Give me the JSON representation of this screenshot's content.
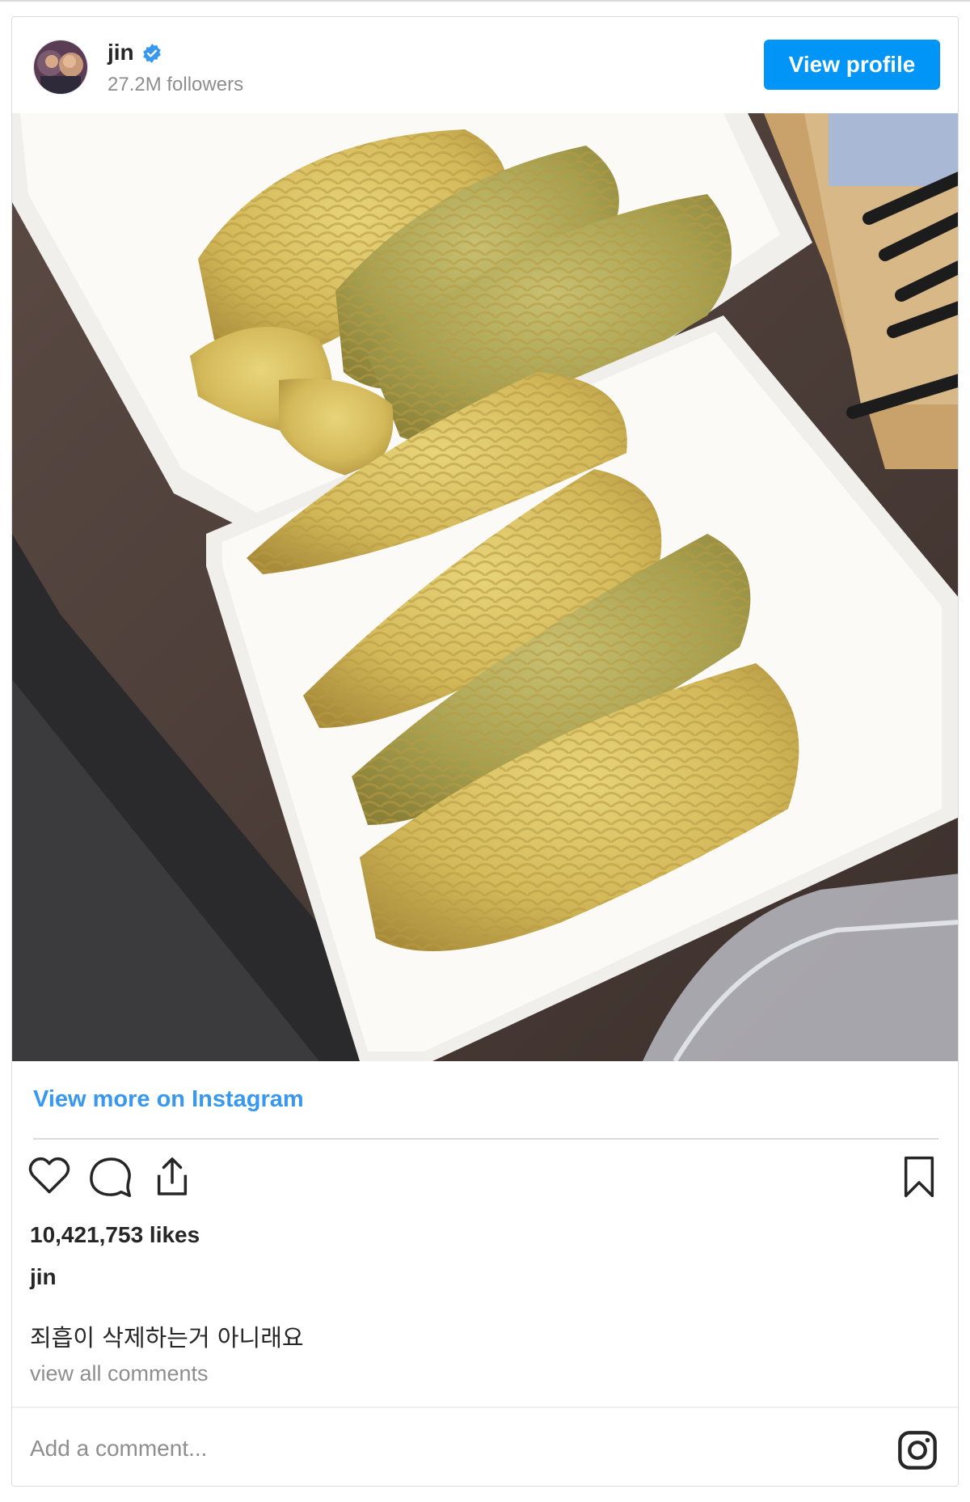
{
  "header": {
    "username": "jin",
    "followers": "27.2M followers",
    "view_profile_label": "View profile"
  },
  "link": {
    "view_more": "View more on Instagram"
  },
  "post": {
    "likes": "10,421,753 likes",
    "author": "jin",
    "caption": "죄흡이 삭제하는거 아니래요",
    "view_comments": "view all comments"
  },
  "comment": {
    "placeholder": "Add a comment..."
  },
  "colors": {
    "accent": "#0095f6",
    "link": "#3897f0",
    "verified": "#3897f0"
  },
  "icons": [
    "verified-badge-icon",
    "heart-icon",
    "comment-icon",
    "share-icon",
    "bookmark-icon",
    "instagram-icon"
  ]
}
